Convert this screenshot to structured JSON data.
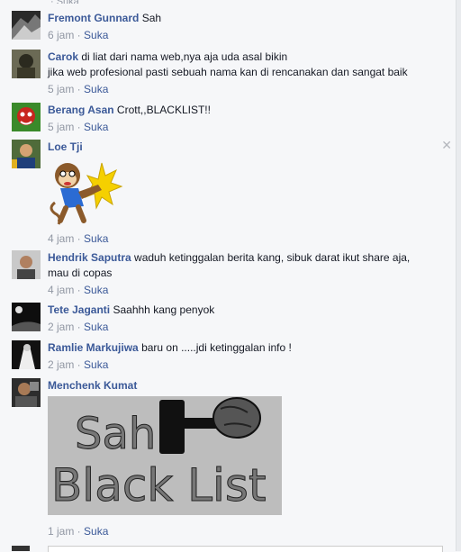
{
  "comments": [
    {
      "author": "Fremont Gunnard",
      "text": "Sah",
      "time": "6 jam",
      "like": "Suka"
    },
    {
      "author": "Carok",
      "text": "di liat dari nama web,nya aja uda asal bikin",
      "text2": "jika web profesional pasti sebuah nama kan di rencanakan dan sangat baik",
      "time": "5 jam",
      "like": "Suka"
    },
    {
      "author": "Berang Asan",
      "text": "Crott,,BLACKLIST!!",
      "time": "5 jam",
      "like": "Suka"
    },
    {
      "author": "Loe Tji",
      "text": "",
      "time": "4 jam",
      "like": "Suka"
    },
    {
      "author": "Hendrik Saputra",
      "text": "waduh ketinggalan berita kang, sibuk darat ikut share aja,",
      "text2": "mau di copas",
      "time": "4 jam",
      "like": "Suka"
    },
    {
      "author": "Tete Jaganti",
      "text": "Saahhh kang penyok",
      "time": "2 jam",
      "like": "Suka"
    },
    {
      "author": "Ramlie Markujiwa",
      "text": "baru on .....jdi ketinggalan info !",
      "time": "2 jam",
      "like": "Suka"
    },
    {
      "author": "Menchenk Kumat",
      "text": "",
      "time": "1 jam",
      "like": "Suka"
    }
  ],
  "image_text": {
    "line1": "Sah",
    "line2": "Black List"
  },
  "close_glyph": "✕",
  "sep": " · "
}
